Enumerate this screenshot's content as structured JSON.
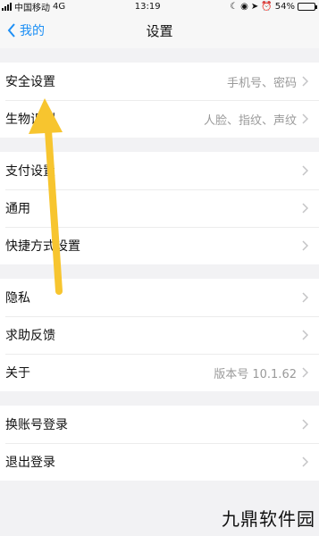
{
  "status": {
    "carrier": "中国移动",
    "network": "4G",
    "time": "13:19",
    "battery_text": "54%",
    "battery_level": 0.54
  },
  "nav": {
    "back_label": "我的",
    "title": "设置"
  },
  "groups": [
    [
      {
        "label": "安全设置",
        "value": "手机号、密码"
      },
      {
        "label": "生物识别",
        "value": "人脸、指纹、声纹"
      }
    ],
    [
      {
        "label": "支付设置",
        "value": ""
      },
      {
        "label": "通用",
        "value": ""
      },
      {
        "label": "快捷方式设置",
        "value": ""
      }
    ],
    [
      {
        "label": "隐私",
        "value": ""
      },
      {
        "label": "求助反馈",
        "value": ""
      },
      {
        "label": "关于",
        "value": "版本号 10.1.62"
      }
    ],
    [
      {
        "label": "换账号登录",
        "value": ""
      },
      {
        "label": "退出登录",
        "value": ""
      }
    ]
  ],
  "annotation": {
    "arrow_color": "#f7c52f"
  },
  "colors": {
    "accent": "#1d8ff5"
  },
  "watermark": "九鼎软件园"
}
